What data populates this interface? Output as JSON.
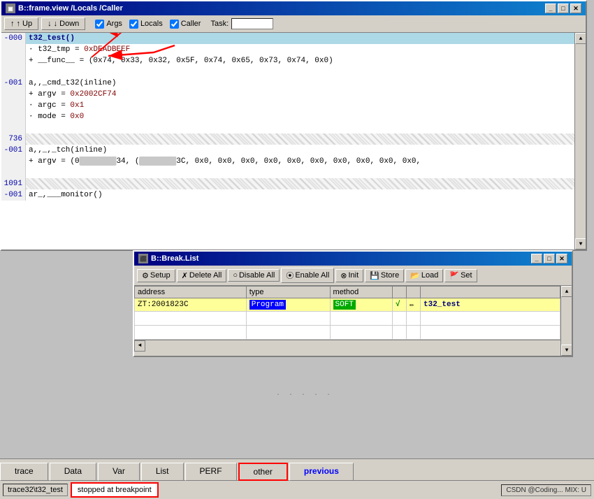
{
  "mainWindow": {
    "title": "B::frame.view /Locals /Caller",
    "toolbar": {
      "upLabel": "↑ Up",
      "downLabel": "↓ Down",
      "argsLabel": "Args",
      "localsLabel": "Locals",
      "callerLabel": "Caller",
      "taskLabel": "Task:"
    },
    "scrollbarUpArrow": "▲",
    "scrollbarDownArrow": "▼"
  },
  "titleButtons": {
    "minimize": "_",
    "maximize": "□",
    "close": "✕"
  },
  "codeLines": [
    {
      "num": "-000",
      "content": "t32_test()",
      "type": "current-frame",
      "indent": 0
    },
    {
      "num": "",
      "content": "· t32_tmp = 0xDEADBEEF",
      "type": "normal",
      "indent": 1
    },
    {
      "num": "",
      "content": "+ __func__ = (0x74, 0x33, 0x32, 0x5F, 0x74, 0x65, 0x73, 0x74, 0x0)",
      "type": "normal",
      "indent": 1
    },
    {
      "num": "",
      "content": "",
      "type": "spacer"
    },
    {
      "num": "-001",
      "content": "a,,_cmd_t32(inline)",
      "type": "normal",
      "indent": 0
    },
    {
      "num": "",
      "content": "+ argv = 0x2002CF74",
      "type": "normal",
      "indent": 1
    },
    {
      "num": "",
      "content": "· argc = 0x1",
      "type": "normal",
      "indent": 1
    },
    {
      "num": "",
      "content": "· mode = 0x0",
      "type": "normal",
      "indent": 1
    },
    {
      "num": "",
      "content": "",
      "type": "spacer"
    },
    {
      "num": "736",
      "content": "",
      "type": "hatch"
    },
    {
      "num": "-001",
      "content": "a,,_,_tch(inline)",
      "type": "normal",
      "indent": 0
    },
    {
      "num": "",
      "content": "+ argv = (0█████34, (████████3C, 0x0, 0x0, 0x0, 0x0, 0x0, 0x0, 0x0, 0x0, 0x0, 0x0,",
      "type": "normal",
      "indent": 1
    },
    {
      "num": "",
      "content": "",
      "type": "spacer"
    },
    {
      "num": "1091",
      "content": "",
      "type": "hatch"
    },
    {
      "num": "-001",
      "content": "ar_,___monitor()",
      "type": "normal",
      "indent": 0
    }
  ],
  "breakWindow": {
    "title": "B::Break.List",
    "toolbar": {
      "setup": "Setup",
      "deleteAll": "Delete All",
      "disableAll": "Disable All",
      "enableAll": "Enable All",
      "init": "Init",
      "store": "Store",
      "load": "Load",
      "set": "Set"
    },
    "table": {
      "headers": [
        "address",
        "type",
        "method",
        "",
        "",
        ""
      ],
      "rows": [
        {
          "address": "ZT:2001823C",
          "type": "Program",
          "method": "SOFT",
          "check": "√",
          "edit": "✏",
          "name": "t32_test"
        }
      ]
    }
  },
  "bottomTabs": [
    {
      "label": "trace",
      "active": false
    },
    {
      "label": "Data",
      "active": false
    },
    {
      "label": "Var",
      "active": false
    },
    {
      "label": "List",
      "active": false
    },
    {
      "label": "PERF",
      "active": false
    },
    {
      "label": "other",
      "active": false,
      "outlined": true
    },
    {
      "label": "previous",
      "active": false,
      "blue": true
    }
  ],
  "statusBar": {
    "path": "trace32\\t32_test",
    "message": "stopped at breakpoint",
    "csdn": "CSDN @Coding... MIX: U"
  },
  "icons": {
    "appIcon": "▶",
    "upArrow": "▲",
    "downArrow": "▼",
    "cross": "✕",
    "xIcon": "✗",
    "radioFilled": "⦿",
    "radioEmpty": "○",
    "circleX": "⊗",
    "person": "👤",
    "disk": "💾",
    "folder": "📂",
    "flag": "🚩",
    "checkmark": "✓",
    "pencil": "✎"
  }
}
